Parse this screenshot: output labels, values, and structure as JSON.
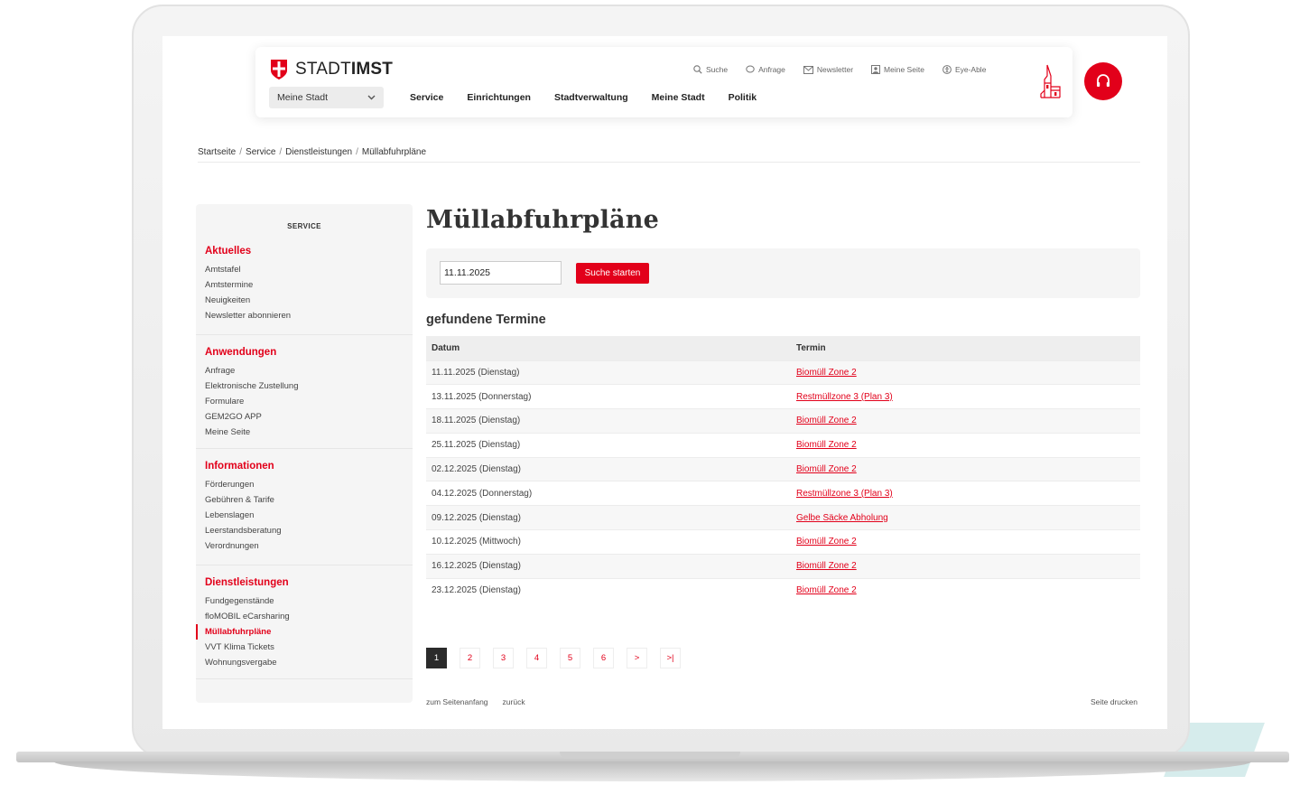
{
  "brand": {
    "logo_light": "STADT",
    "logo_bold": "IMST",
    "accent_color": "#e2001a"
  },
  "header": {
    "city_select": "Meine Stadt",
    "main_nav": [
      "Service",
      "Einrichtungen",
      "Stadtverwaltung",
      "Meine Stadt",
      "Politik"
    ],
    "top_nav": [
      {
        "label": "Suche",
        "icon": "search-icon"
      },
      {
        "label": "Anfrage",
        "icon": "chat-icon"
      },
      {
        "label": "Newsletter",
        "icon": "mail-icon"
      },
      {
        "label": "Meine Seite",
        "icon": "user-icon"
      },
      {
        "label": "Eye-Able",
        "icon": "accessibility-icon"
      }
    ],
    "help_icon": "headset-icon"
  },
  "breadcrumb": [
    "Startseite",
    "Service",
    "Dienstleistungen",
    "Müllabfuhrpläne"
  ],
  "sidebar": {
    "title": "SERVICE",
    "groups": [
      {
        "heading": "Aktuelles",
        "items": [
          "Amtstafel",
          "Amtstermine",
          "Neuigkeiten",
          "Newsletter abonnieren"
        ]
      },
      {
        "heading": "Anwendungen",
        "items": [
          "Anfrage",
          "Elektronische Zustellung",
          "Formulare",
          "GEM2GO APP",
          "Meine Seite"
        ]
      },
      {
        "heading": "Informationen",
        "items": [
          "Förderungen",
          "Gebühren & Tarife",
          "Lebenslagen",
          "Leerstandsberatung",
          "Verordnungen"
        ]
      },
      {
        "heading": "Dienstleistungen",
        "items": [
          "Fundgegenstände",
          "floMOBIL eCarsharing",
          "Müllabfuhrpläne",
          "VVT Klima Tickets",
          "Wohnungsvergabe"
        ]
      }
    ],
    "active_item": "Müllabfuhrpläne"
  },
  "main": {
    "title": "Müllabfuhrpläne",
    "date_value": "11.11.2025",
    "search_button": "Suche starten",
    "found_title": "gefundene Termine",
    "columns": [
      "Datum",
      "Termin"
    ],
    "rows": [
      [
        "11.11.2025 (Dienstag)",
        "Biomüll Zone 2"
      ],
      [
        "13.11.2025 (Donnerstag)",
        "Restmüllzone 3 (Plan 3)"
      ],
      [
        "18.11.2025 (Dienstag)",
        "Biomüll Zone 2"
      ],
      [
        "25.11.2025 (Dienstag)",
        "Biomüll Zone 2"
      ],
      [
        "02.12.2025 (Dienstag)",
        "Biomüll Zone 2"
      ],
      [
        "04.12.2025 (Donnerstag)",
        "Restmüllzone 3 (Plan 3)"
      ],
      [
        "09.12.2025 (Dienstag)",
        "Gelbe Säcke Abholung"
      ],
      [
        "10.12.2025 (Mittwoch)",
        "Biomüll Zone 2"
      ],
      [
        "16.12.2025 (Dienstag)",
        "Biomüll Zone 2"
      ],
      [
        "23.12.2025 (Dienstag)",
        "Biomüll Zone 2"
      ]
    ],
    "pagination": [
      "1",
      "2",
      "3",
      "4",
      "5",
      "6",
      ">",
      ">|"
    ],
    "current_page": "1"
  },
  "footer": {
    "to_top": "zum Seitenanfang",
    "back": "zurück",
    "print": "Seite drucken"
  }
}
